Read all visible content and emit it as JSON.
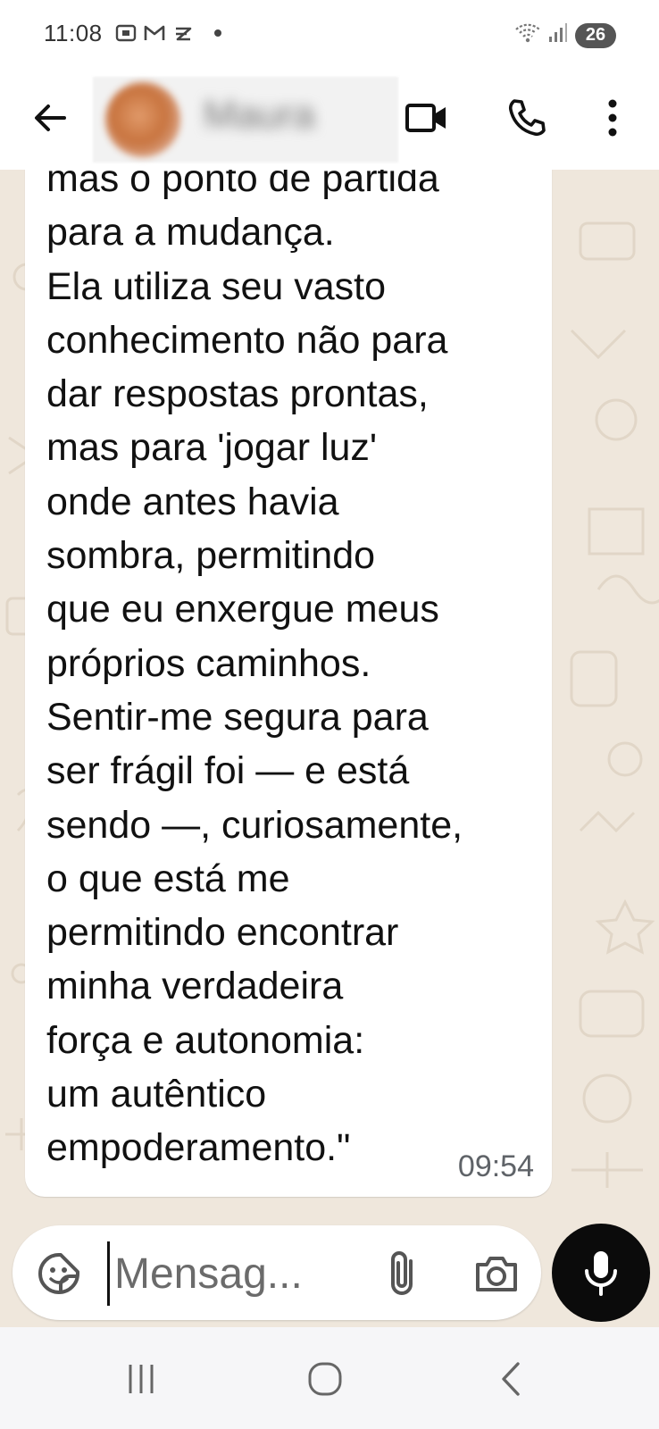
{
  "status_bar": {
    "time": "11:08",
    "battery": "26"
  },
  "header": {
    "contact_name": "Maura"
  },
  "message": {
    "lines": [
      "mas o ponto de partida",
      "para a mudança.",
      "Ela utiliza seu vasto",
      "conhecimento não para",
      "dar respostas prontas,",
      "mas para 'jogar luz'",
      "onde antes havia",
      "sombra, permitindo",
      "que eu enxergue meus",
      "próprios caminhos.",
      "Sentir-me segura para",
      "ser frágil foi — e está",
      "sendo —, curiosamente,",
      "o que está me",
      "permitindo encontrar",
      "minha verdadeira",
      "força e autonomia:",
      "um autêntico",
      "empoderamento.\""
    ],
    "time": "09:54"
  },
  "composer": {
    "placeholder": "Mensag..."
  },
  "colors": {
    "chat_background": "#efe7dc",
    "mic_button": "#0b0b0b",
    "bubble": "#ffffff"
  },
  "icons": {
    "back": "arrow-left-icon",
    "video": "video-camera-icon",
    "phone": "phone-icon",
    "more": "more-vertical-icon",
    "emoji": "sticker-icon",
    "attach": "paperclip-icon",
    "camera": "camera-icon",
    "mic": "microphone-icon"
  }
}
